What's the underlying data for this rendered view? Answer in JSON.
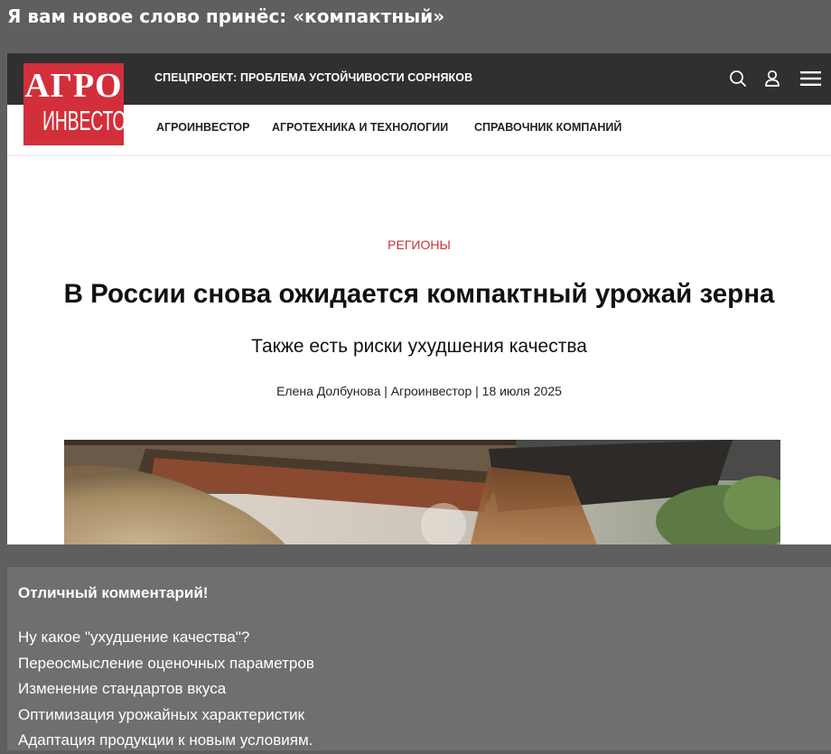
{
  "post": {
    "title": "Я вам новое слово принёс: «компактный»"
  },
  "site": {
    "logo_line1": "АГРО",
    "logo_line2": "ИНВЕСТОР",
    "special_project": "СПЕЦПРОЕКТ: ПРОБЛЕМА УСТОЙЧИВОСТИ СОРНЯКОВ",
    "nav": [
      "АГРОИНВЕСТОР",
      "АГРОТЕХНИКА И ТЕХНОЛОГИИ",
      "СПРАВОЧНИК КОМПАНИЙ"
    ],
    "icons": [
      "search-icon",
      "user-icon",
      "menu-icon"
    ]
  },
  "article": {
    "category": "РЕГИОНЫ",
    "headline": "В России снова ожидается компактный урожай зерна",
    "subheadline": "Также есть риски ухудшения качества",
    "byline": "Елена Долбунова | Агроинвестор |   18 июля 2025"
  },
  "comment": {
    "title": "Отличный комментарий!",
    "lines": [
      "Ну какое \"ухудшение качества\"?",
      "Переосмысление оценочных параметров",
      "Изменение стандартов вкуса",
      "Оптимизация урожайных характеристик",
      "Адаптация продукции к новым условиям."
    ]
  },
  "colors": {
    "brand_red": "#d32f3a",
    "topbar": "#303030",
    "category_red": "#c8323b",
    "page_bg": "#5f5f5f",
    "comment_bg": "#6f6f6f"
  }
}
